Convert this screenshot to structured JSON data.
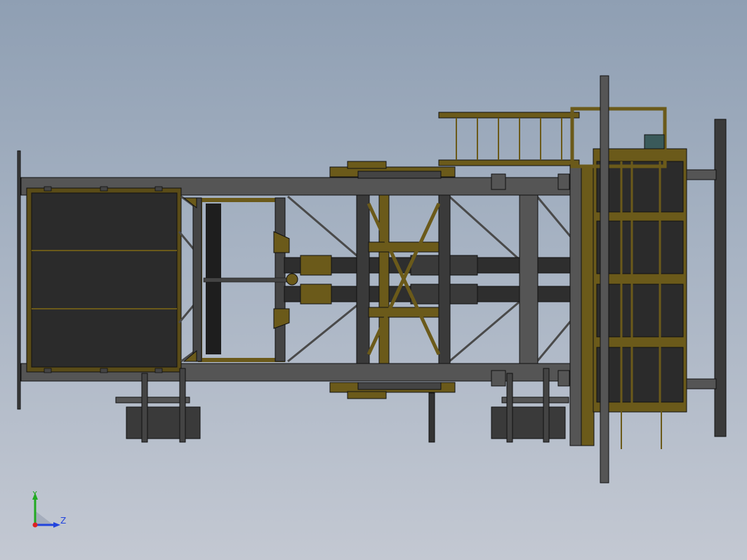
{
  "viewport": {
    "background_top": "#8f9fb3",
    "background_bottom": "#c3c8d2"
  },
  "colors": {
    "steel_dark": "#3d3d3d",
    "steel_mid": "#555555",
    "steel_light": "#6e6e6e",
    "panel_fill": "#2a2a2a",
    "yellow": "#6b5a1a",
    "yellow_light": "#8a7425",
    "outline": "#111111",
    "y_axis": "#22aa22",
    "z_axis": "#2244dd",
    "origin": "#dd2222"
  },
  "triad": {
    "y_label": "Y",
    "z_label": "Z",
    "icon": "coordinate-triad-icon"
  }
}
